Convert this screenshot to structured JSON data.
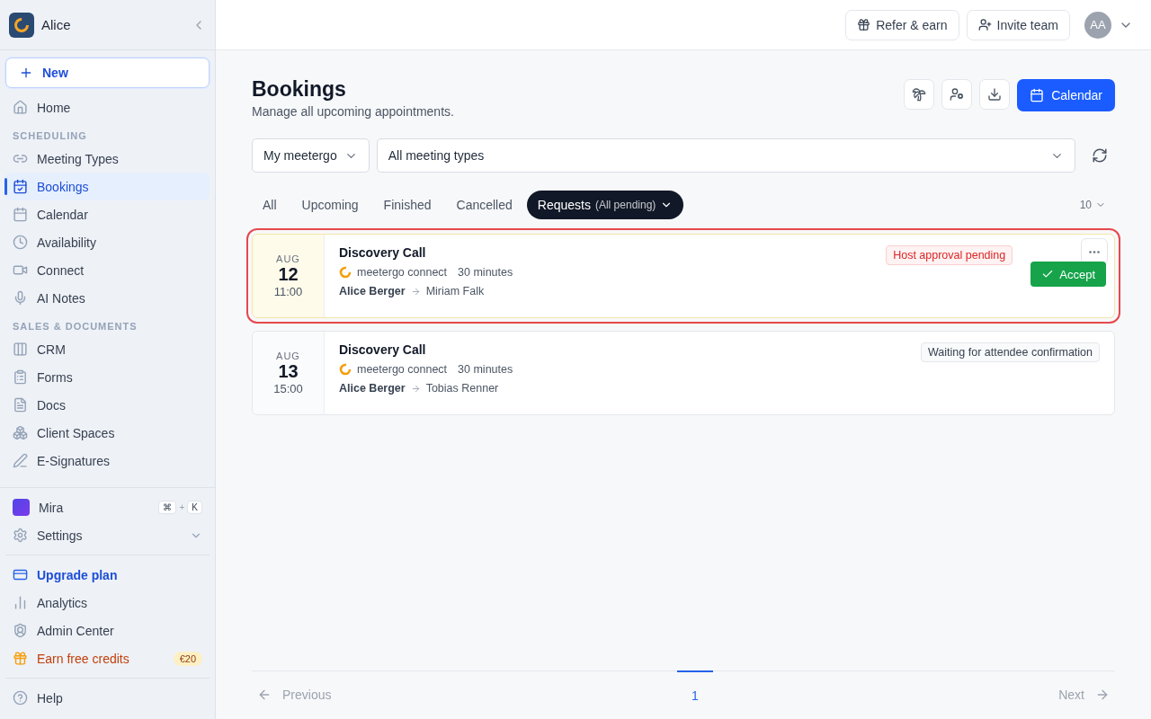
{
  "sidebar": {
    "workspace": "Alice",
    "new_button": "New",
    "sections": [
      {
        "items": [
          {
            "label": "Home",
            "selected": false
          }
        ]
      },
      {
        "heading": "SCHEDULING",
        "items": [
          {
            "label": "Meeting Types",
            "selected": false
          },
          {
            "label": "Bookings",
            "selected": true
          },
          {
            "label": "Calendar",
            "selected": false
          },
          {
            "label": "Availability",
            "selected": false
          },
          {
            "label": "Connect",
            "selected": false
          },
          {
            "label": "AI Notes",
            "selected": false
          }
        ]
      },
      {
        "heading": "SALES & DOCUMENTS",
        "items": [
          {
            "label": "CRM",
            "selected": false
          },
          {
            "label": "Forms",
            "selected": false
          },
          {
            "label": "Docs",
            "selected": false
          },
          {
            "label": "Client Spaces",
            "selected": false
          },
          {
            "label": "E-Signatures",
            "selected": false
          }
        ]
      }
    ],
    "assistant": {
      "label": "Mira",
      "keys": [
        "⌘",
        "+",
        "K"
      ]
    },
    "settings": {
      "label": "Settings",
      "expanded": false
    },
    "footer_items": [
      {
        "label": "Upgrade plan",
        "kind": "upgrade"
      },
      {
        "label": "Analytics",
        "kind": "normal"
      },
      {
        "label": "Admin Center",
        "kind": "normal"
      },
      {
        "label": "Earn free credits",
        "kind": "credits",
        "badge": "€20"
      }
    ],
    "help": "Help"
  },
  "header": {
    "buttons": [
      "Refer & earn",
      "Invite team"
    ],
    "avatar": "AA"
  },
  "page": {
    "title": "Bookings",
    "subtitle": "Manage all upcoming appointments.",
    "primary_button": "Calendar"
  },
  "filters": {
    "owner": "My meetergo",
    "meeting_type": "All meeting types"
  },
  "tabs": [
    {
      "label": "All",
      "selected": false
    },
    {
      "label": "Upcoming",
      "selected": false
    },
    {
      "label": "Finished",
      "selected": false
    },
    {
      "label": "Cancelled",
      "selected": false
    },
    {
      "label": "Requests",
      "note": "(All pending)",
      "selected": true
    }
  ],
  "page_size": "10",
  "bookings": [
    {
      "month": "AUG",
      "day": "12",
      "time": "11:00",
      "title": "Discovery Call",
      "location": "meetergo connect",
      "duration": "30 minutes",
      "host": "Alice Berger",
      "attendee": "Miriam Falk",
      "status": {
        "label": "Host approval pending",
        "kind": "pending"
      },
      "action": "Accept",
      "highlighted": true
    },
    {
      "month": "AUG",
      "day": "13",
      "time": "15:00",
      "title": "Discovery Call",
      "location": "meetergo connect",
      "duration": "30 minutes",
      "host": "Alice Berger",
      "attendee": "Tobias Renner",
      "status": {
        "label": "Waiting for attendee confirmation",
        "kind": "waiting"
      },
      "highlighted": false
    }
  ],
  "pagination": {
    "previous": "Previous",
    "pages": [
      {
        "label": "1",
        "selected": true
      }
    ],
    "next": "Next",
    "previous_disabled": true,
    "next_disabled": true
  }
}
